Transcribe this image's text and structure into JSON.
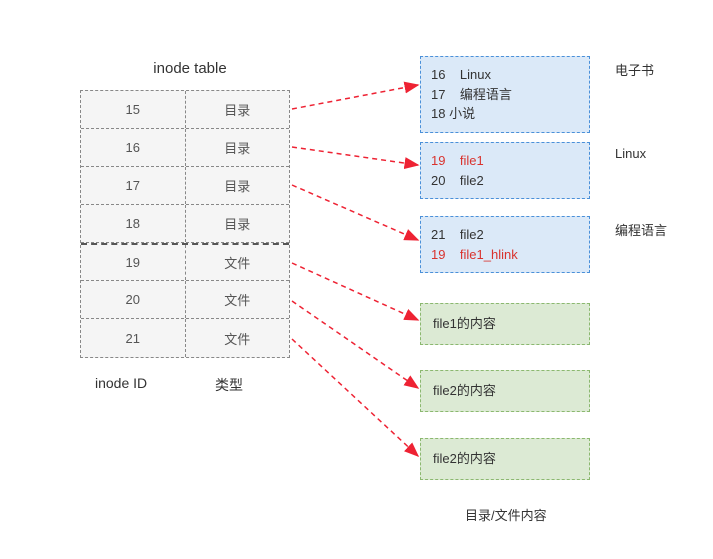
{
  "titles": {
    "inode_table": "inode table",
    "inode_id": "inode ID",
    "type_label": "类型",
    "content_label": "目录/文件内容"
  },
  "inode_rows": [
    {
      "id": "15",
      "type": "目录"
    },
    {
      "id": "16",
      "type": "目录"
    },
    {
      "id": "17",
      "type": "目录"
    },
    {
      "id": "18",
      "type": "目录"
    },
    {
      "id": "19",
      "type": "文件"
    },
    {
      "id": "20",
      "type": "文件"
    },
    {
      "id": "21",
      "type": "文件"
    }
  ],
  "dir_boxes": {
    "ebook": {
      "label": "电子书",
      "entries": [
        {
          "text": "16    Linux",
          "red": false
        },
        {
          "text": "17    编程语言",
          "red": false
        },
        {
          "text": "18 小说",
          "red": false
        }
      ]
    },
    "linux": {
      "label": "Linux",
      "entries": [
        {
          "text": "19    file1",
          "red": true
        },
        {
          "text": "20    file2",
          "red": false
        }
      ]
    },
    "prog": {
      "label": "编程语言",
      "entries": [
        {
          "text": "21    file2",
          "red": false
        },
        {
          "text": "19    file1_hlink",
          "red": true
        }
      ]
    }
  },
  "file_boxes": {
    "f1": "file1的内容",
    "f2": "file2的内容",
    "f3": "file2的内容"
  },
  "diagram": {
    "description": "inode table maps inode IDs to types; arrows show each inode pointing to its directory or file content block. Hard link file1_hlink in 编程语言 directory points to same inode 19 as file1 in Linux directory.",
    "arrows": [
      {
        "from_inode": "15",
        "to": "电子书 directory contents"
      },
      {
        "from_inode": "16",
        "to": "Linux directory contents"
      },
      {
        "from_inode": "17",
        "to": "编程语言 directory contents"
      },
      {
        "from_inode": "19",
        "to": "file1的内容"
      },
      {
        "from_inode": "20",
        "to": "file2的内容"
      },
      {
        "from_inode": "21",
        "to": "file2的内容"
      }
    ]
  }
}
